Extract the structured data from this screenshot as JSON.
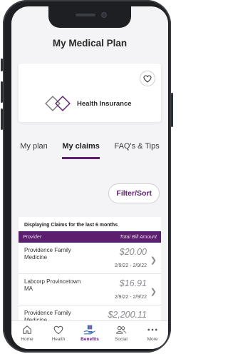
{
  "header": {
    "title": "My Medical Plan"
  },
  "plan_card": {
    "logo_text": "Health Insurance"
  },
  "tabs": [
    {
      "label": "My plan",
      "active": false
    },
    {
      "label": "My claims",
      "active": true
    },
    {
      "label": "FAQ's & Tips",
      "active": false
    }
  ],
  "filter": {
    "label": "Filter/Sort"
  },
  "claims": {
    "note": "Displaying Claims for the last 6 months",
    "col_provider": "Provider",
    "col_amount": "Total Bill Amount",
    "rows": [
      {
        "provider": "Providence Family Medicine",
        "amount": "$20.00",
        "dates": "2/9/22 - 2/9/22"
      },
      {
        "provider": "Labcorp Provincetown MA",
        "amount": "$16.91",
        "dates": "2/9/22 - 2/9/22"
      },
      {
        "provider": "Providence Family Medicine",
        "amount": "$2,200.11",
        "dates": ""
      }
    ]
  },
  "nav": [
    {
      "label": "Home",
      "icon": "home-icon",
      "active": false
    },
    {
      "label": "Health",
      "icon": "heart-icon",
      "active": false
    },
    {
      "label": "Benefits",
      "icon": "benefits-icon",
      "active": true
    },
    {
      "label": "Social",
      "icon": "social-icon",
      "active": false
    },
    {
      "label": "More",
      "icon": "more-icon",
      "active": false
    }
  ],
  "colors": {
    "accent": "#5c1f6d",
    "background": "#f4f4f6"
  }
}
